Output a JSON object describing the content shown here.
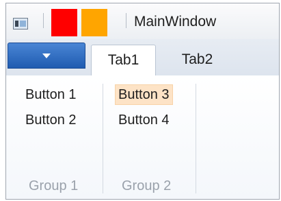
{
  "window": {
    "title": "MainWindow"
  },
  "quick_access": {
    "items": [
      {
        "name": "red-square",
        "color": "#ff0000"
      },
      {
        "name": "orange-square",
        "color": "#ffa500"
      }
    ]
  },
  "ribbon": {
    "application_menu_icon": "chevron-down-icon",
    "tabs": [
      {
        "label": "Tab1",
        "selected": true
      },
      {
        "label": "Tab2",
        "selected": false
      }
    ],
    "groups": [
      {
        "label": "Group 1",
        "buttons": [
          {
            "label": "Button 1"
          },
          {
            "label": "Button 2"
          }
        ]
      },
      {
        "label": "Group 2",
        "buttons": [
          {
            "label": "Button 3",
            "highlighted": true
          },
          {
            "label": "Button 4"
          }
        ]
      }
    ]
  },
  "colors": {
    "app_menu_button": "#2b68c0",
    "hover_highlight": "#fde3c6"
  }
}
